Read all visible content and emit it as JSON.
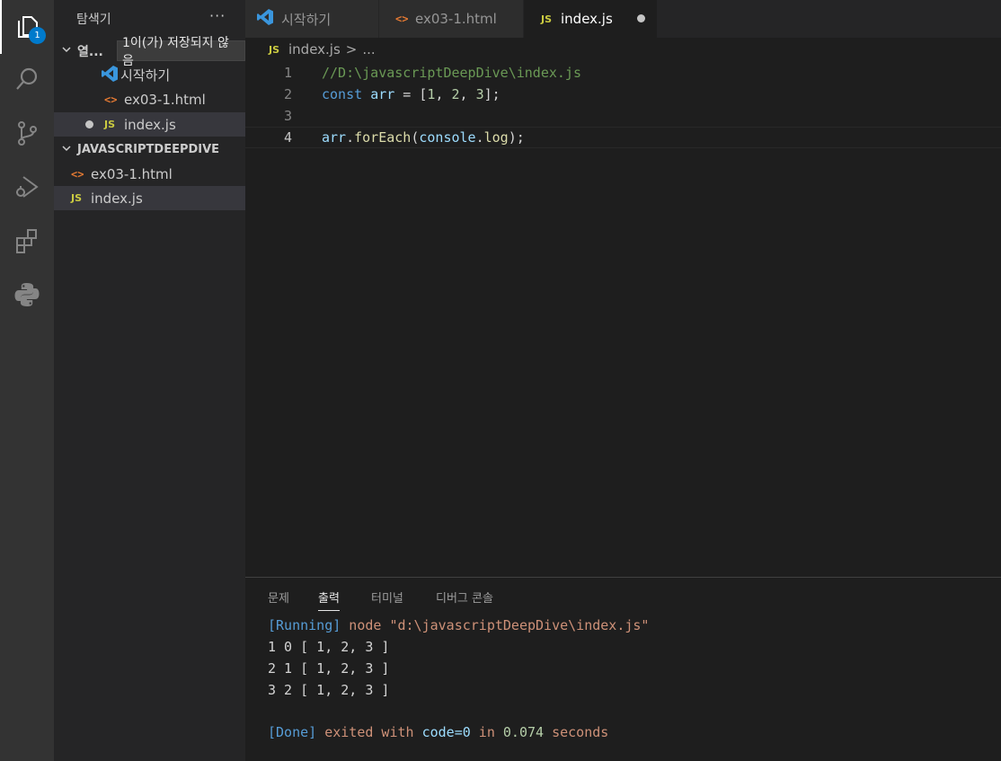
{
  "activity_bar": {
    "explorer_badge": "1",
    "items": [
      {
        "name": "explorer-icon"
      },
      {
        "name": "search-icon"
      },
      {
        "name": "source-control-icon"
      },
      {
        "name": "run-debug-icon"
      },
      {
        "name": "extensions-icon"
      },
      {
        "name": "python-icon"
      }
    ]
  },
  "sidebar": {
    "title": "탐색기",
    "more": "···",
    "open_editors_label": "열...",
    "unsaved_tooltip": "1이(가) 저장되지 않음",
    "open_editors": [
      {
        "label": "시작하기",
        "icon": "vscode-icon"
      },
      {
        "label": "ex03-1.html",
        "icon": "html-icon"
      },
      {
        "label": "index.js",
        "icon": "js-icon",
        "unsaved": true
      }
    ],
    "folder_label": "JAVASCRIPTDEEPDIVE",
    "folder_files": [
      {
        "label": "ex03-1.html",
        "icon": "html-icon"
      },
      {
        "label": "index.js",
        "icon": "js-icon"
      }
    ]
  },
  "tabs": [
    {
      "label": "시작하기",
      "icon": "vscode-icon"
    },
    {
      "label": "ex03-1.html",
      "icon": "html-icon"
    },
    {
      "label": "index.js",
      "icon": "js-icon",
      "active": true,
      "unsaved": true
    }
  ],
  "js_icon_text": "JS",
  "html_icon_text": "<>",
  "breadcrumb": {
    "file": "index.js",
    "separator": ">",
    "rest": "..."
  },
  "editor": {
    "line_numbers": [
      "1",
      "2",
      "3",
      "4"
    ],
    "line1": {
      "comment": "//D:\\javascriptDeepDive\\index.js"
    },
    "line2": {
      "kw": "const",
      "var": "arr",
      "eq": " = [",
      "n1": "1",
      "c1": ", ",
      "n2": "2",
      "c2": ", ",
      "n3": "3",
      "end": "];"
    },
    "line4": {
      "obj": "arr",
      "dot": ".",
      "fn": "forEach",
      "open": "(",
      "arg": "console",
      "dot2": ".",
      "prop": "log",
      "close": ");"
    }
  },
  "panel": {
    "tabs": [
      "문제",
      "출력",
      "터미널",
      "디버그 콘솔"
    ],
    "active_tab": "출력",
    "output": {
      "running_tag": "[Running]",
      "running_cmd": " node \"d:\\javascriptDeepDive\\index.js\"",
      "lines": [
        "1 0 [ 1, 2, 3 ]",
        "2 1 [ 1, 2, 3 ]",
        "3 2 [ 1, 2, 3 ]"
      ],
      "done_tag": "[Done]",
      "done_text1": " exited with ",
      "done_code": "code=0",
      "done_text2": " in ",
      "done_time": "0.074",
      "done_text3": " seconds"
    }
  },
  "colors": {
    "accent": "#007acc",
    "js_yellow": "#cbcb41",
    "html_orange": "#e37933"
  }
}
